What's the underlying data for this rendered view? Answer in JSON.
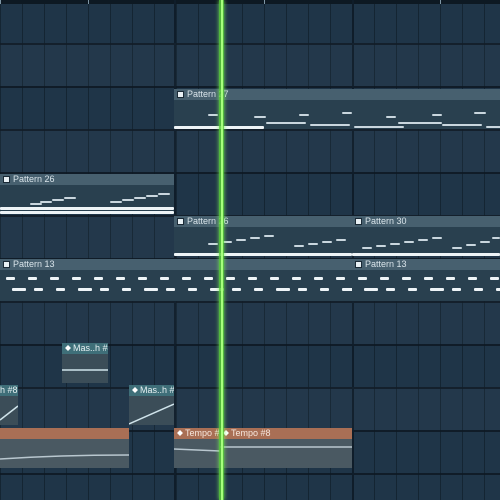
{
  "app": "Playlist",
  "playhead": {
    "color": "#5bcf3c"
  },
  "clips": {
    "pattern27": {
      "label": "Pattern 27",
      "icon": "pattern-icon"
    },
    "pattern26_a": {
      "label": "Pattern 26",
      "icon": "pattern-icon"
    },
    "pattern26_b": {
      "label": "Pattern 26",
      "icon": "pattern-icon"
    },
    "pattern30": {
      "label": "Pattern 30",
      "icon": "pattern-icon"
    },
    "pattern13_a": {
      "label": "Pattern 13",
      "icon": "pattern-icon"
    },
    "pattern13_b": {
      "label": "Pattern 13",
      "icon": "pattern-icon"
    }
  },
  "automation": {
    "mas_1": {
      "label": "Mas..h #4",
      "icon": "automation-icon"
    },
    "mas_2_left": {
      "label": "h #8",
      "icon": "automation-icon"
    },
    "mas_2_right": {
      "label": "Mas..h #8",
      "icon": "automation-icon"
    },
    "tempo_1": {
      "label": "Tempo #6",
      "icon": "automation-icon"
    },
    "tempo_2": {
      "label": "Tempo #8",
      "icon": "automation-icon"
    }
  },
  "colors": {
    "background": "#1f3548",
    "clip_header": "#47606f",
    "automation_header": "#3f6f79",
    "tempo_header": "#a96f55"
  }
}
